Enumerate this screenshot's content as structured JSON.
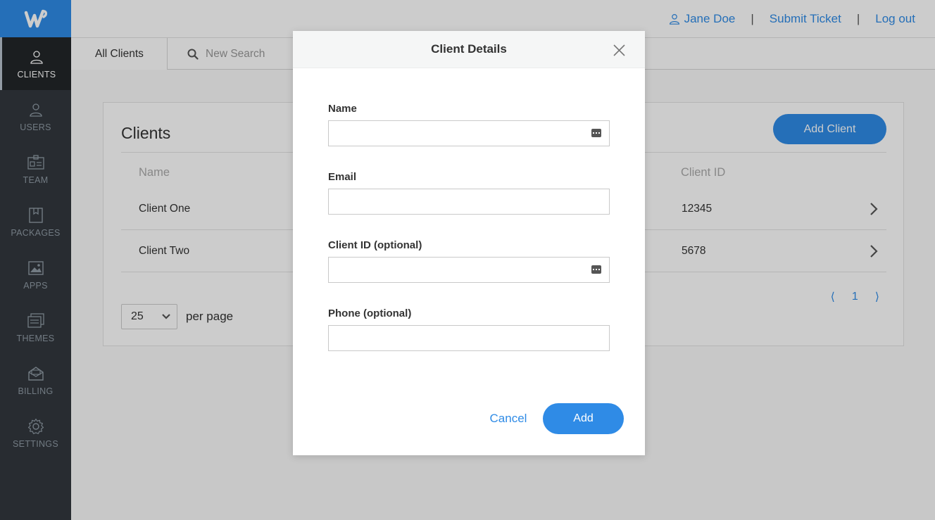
{
  "header": {
    "user_name": "Jane Doe",
    "separator": "|",
    "submit_ticket": "Submit Ticket",
    "log_out": "Log out"
  },
  "sidebar": {
    "items": [
      {
        "label": "CLIENTS",
        "icon": "person-icon"
      },
      {
        "label": "USERS",
        "icon": "person-icon"
      },
      {
        "label": "TEAM",
        "icon": "id-card-icon"
      },
      {
        "label": "PACKAGES",
        "icon": "package-icon"
      },
      {
        "label": "APPS",
        "icon": "image-icon"
      },
      {
        "label": "THEMES",
        "icon": "layers-icon"
      },
      {
        "label": "BILLING",
        "icon": "envelope-icon"
      },
      {
        "label": "SETTINGS",
        "icon": "gear-icon"
      }
    ]
  },
  "subnav": {
    "tab_all": "All Clients",
    "search_placeholder": "New Search"
  },
  "clients_card": {
    "title": "Clients",
    "add_button": "Add Client",
    "columns": {
      "name": "Name",
      "client_id": "Client ID"
    },
    "rows": [
      {
        "name": "Client One",
        "client_id": "12345"
      },
      {
        "name": "Client Two",
        "client_id": "5678"
      }
    ],
    "per_page_value": "25",
    "per_page_label": "per page",
    "pager": {
      "prev": "⟨",
      "page": "1",
      "next": "⟩"
    }
  },
  "modal": {
    "title": "Client Details",
    "fields": [
      {
        "label": "Name",
        "value": ""
      },
      {
        "label": "Email",
        "value": ""
      },
      {
        "label": "Client ID (optional)",
        "value": ""
      },
      {
        "label": "Phone (optional)",
        "value": ""
      }
    ],
    "cancel": "Cancel",
    "add": "Add"
  },
  "colors": {
    "accent": "#2f8be6",
    "sidebar_bg": "#32383e",
    "sidebar_active": "#222629"
  }
}
